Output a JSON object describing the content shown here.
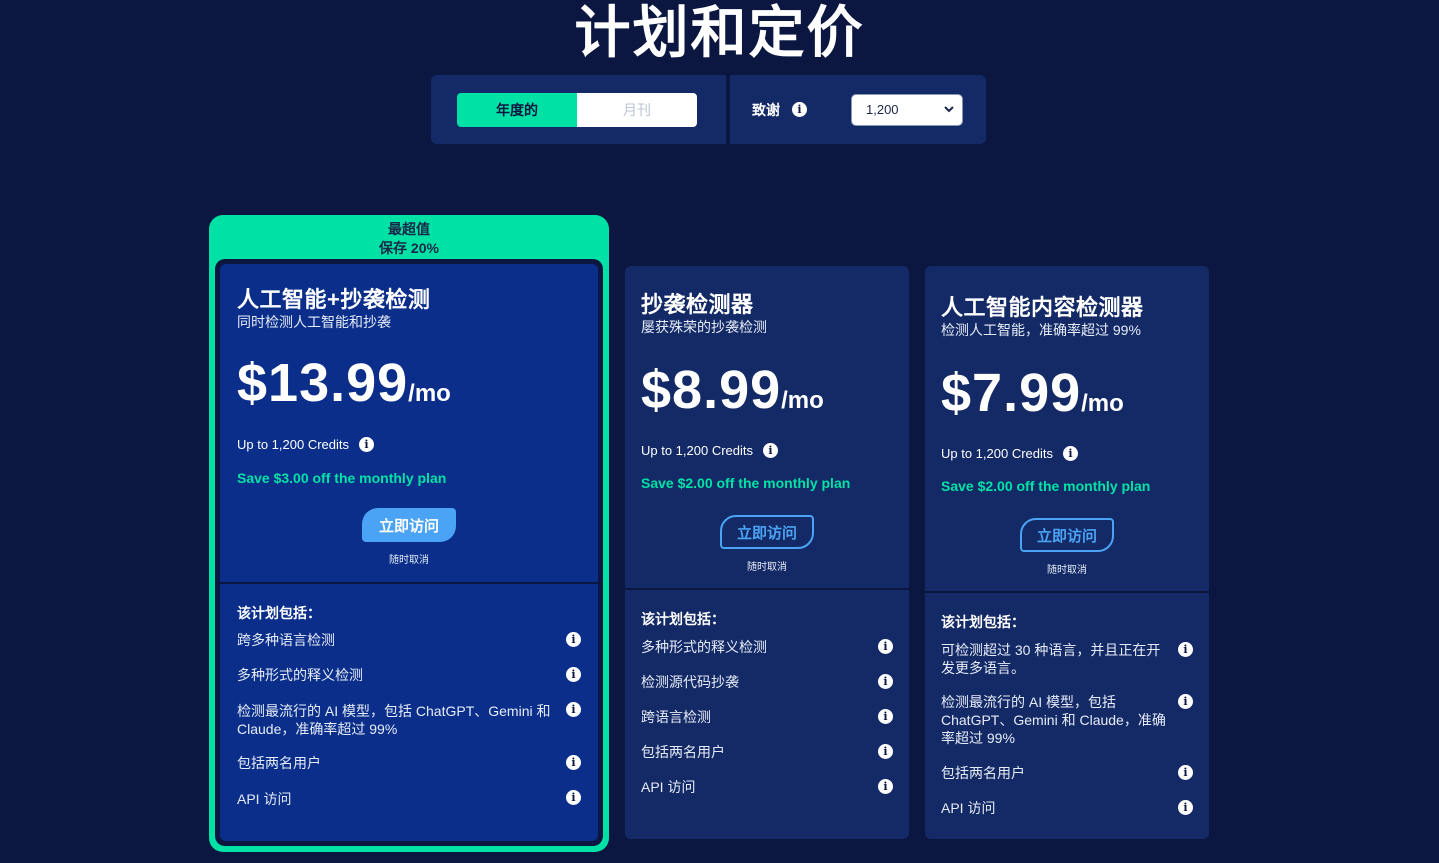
{
  "page_title": "计划和定价",
  "billing_toggle": {
    "annual_label": "年度的",
    "monthly_label": "月刊"
  },
  "credits": {
    "label": "致谢",
    "selected_value": "1,200"
  },
  "featured": {
    "badge_line1": "最超值",
    "badge_line2": "保存 20%"
  },
  "plans": [
    {
      "name": "人工智能+抄袭检测",
      "description": "同时检测人工智能和抄袭",
      "price": "$13.99",
      "period": "/mo",
      "credits_text": "Up to 1,200 Credits",
      "savings_text": "Save $3.00 off the monthly plan",
      "cta_label": "立即访问",
      "cancel_note": "随时取消",
      "includes_label": "该计划包括：",
      "features": [
        {
          "line1": "跨多种语言检测",
          "line2": ""
        },
        {
          "line1": "多种形式的释义检测",
          "line2": ""
        },
        {
          "line1": "检测最流行的 AI 模型，包括 ChatGPT、Gemini 和",
          "line2": "Claude，准确率超过 99%"
        },
        {
          "line1": "包括两名用户",
          "line2": ""
        },
        {
          "line1": "API 访问",
          "line2": ""
        }
      ]
    },
    {
      "name": "抄袭检测器",
      "description": "屡获殊荣的抄袭检测",
      "price": "$8.99",
      "period": "/mo",
      "credits_text": "Up to 1,200 Credits",
      "savings_text": "Save $2.00 off the monthly plan",
      "cta_label": "立即访问",
      "cancel_note": "随时取消",
      "includes_label": "该计划包括：",
      "features": [
        {
          "line1": "多种形式的释义检测"
        },
        {
          "line1": "检测源代码抄袭"
        },
        {
          "line1": "跨语言检测"
        },
        {
          "line1": "包括两名用户"
        },
        {
          "line1": "API 访问"
        }
      ]
    },
    {
      "name": "人工智能内容检测器",
      "description": "检测人工智能，准确率超过 99%",
      "price": "$7.99",
      "period": "/mo",
      "credits_text": "Up to 1,200 Credits",
      "savings_text": "Save $2.00 off the monthly plan",
      "cta_label": "立即访问",
      "cancel_note": "随时取消",
      "includes_label": "该计划包括：",
      "features": [
        {
          "line1": "可检测超过 30 种语言，并且正在开",
          "line2": "发更多语言。",
          "line3": ""
        },
        {
          "line1": "检测最流行的 AI 模型，包括",
          "line2": "ChatGPT、Gemini 和 Claude，准确",
          "line3": "率超过 99%"
        },
        {
          "line1": "包括两名用户",
          "line2": "",
          "line3": ""
        },
        {
          "line1": "API 访问",
          "line2": "",
          "line3": ""
        }
      ]
    }
  ],
  "colors": {
    "background": "#0b1740",
    "card": "#142a66",
    "featured_card": "#0a2e8a",
    "accent_green": "#00e2a5",
    "accent_blue": "#4aa3f5"
  },
  "icons": {
    "info": "info-icon",
    "dropdown": "chevron-down-icon"
  }
}
